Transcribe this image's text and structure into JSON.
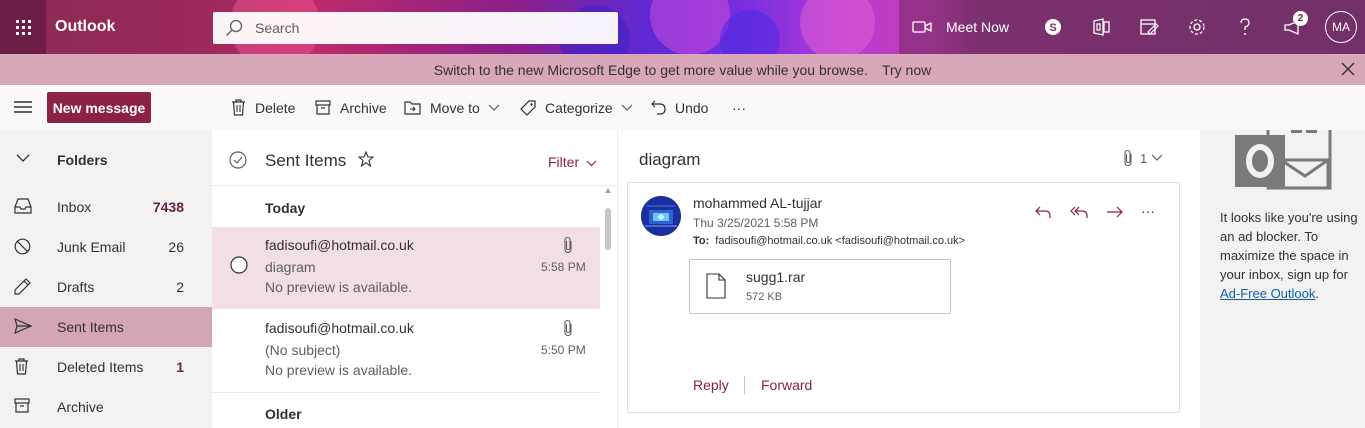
{
  "app": {
    "name": "Outlook"
  },
  "search": {
    "placeholder": "Search"
  },
  "header": {
    "meet_now_label": "Meet Now",
    "notification_count": "2",
    "avatar_initials": "MA"
  },
  "banner": {
    "message": "Switch to the new Microsoft Edge to get more value while you browse.",
    "action": "Try now"
  },
  "toolbar": {
    "new_message": "New message",
    "delete": "Delete",
    "archive": "Archive",
    "move_to": "Move to",
    "categorize": "Categorize",
    "undo": "Undo",
    "more": "···"
  },
  "folders": {
    "header": "Folders",
    "items": [
      {
        "label": "Inbox",
        "count": "7438",
        "icon": "inbox-icon"
      },
      {
        "label": "Junk Email",
        "count": "26",
        "icon": "junk-icon"
      },
      {
        "label": "Drafts",
        "count": "2",
        "icon": "pencil-icon"
      },
      {
        "label": "Sent Items",
        "count": "",
        "icon": "send-icon",
        "selected": true
      },
      {
        "label": "Deleted Items",
        "count": "1",
        "icon": "trash-icon"
      },
      {
        "label": "Archive",
        "count": "",
        "icon": "archive-icon"
      }
    ]
  },
  "message_list": {
    "title": "Sent Items",
    "filter_label": "Filter",
    "groups": [
      "Today",
      "Older"
    ],
    "messages": [
      {
        "from": "fadisoufi@hotmail.co.uk",
        "subject": "diagram",
        "preview": "No preview is available.",
        "time": "5:58 PM",
        "has_attachment": true,
        "selected": true
      },
      {
        "from": "fadisoufi@hotmail.co.uk",
        "subject": "(No subject)",
        "preview": "No preview is available.",
        "time": "5:50 PM",
        "has_attachment": true,
        "selected": false
      }
    ]
  },
  "reading_pane": {
    "subject": "diagram",
    "attachment_count": "1",
    "sender": "mohammed AL-tujjar",
    "date": "Thu 3/25/2021 5:58 PM",
    "to_label": "To:",
    "to_value": "fadisoufi@hotmail.co.uk <fadisoufi@hotmail.co.uk>",
    "attachment": {
      "name": "sugg1.rar",
      "size": "572 KB"
    },
    "reply_label": "Reply",
    "forward_label": "Forward",
    "more": "···"
  },
  "ad_pane": {
    "text_before": "It looks like you're using an ad blocker. To maximize the space in your inbox, sign up for",
    "link": "Ad-Free Outlook",
    "text_after": "."
  },
  "colors": {
    "brand": "#8c2147",
    "banner": "#d9a7ba",
    "selected_folder": "#d3a6b6",
    "selected_message": "#f2dfe6"
  }
}
